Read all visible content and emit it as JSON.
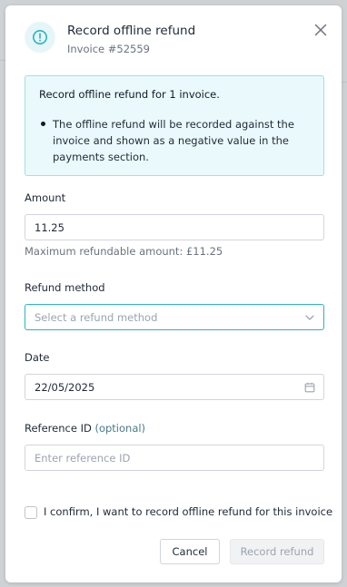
{
  "modal": {
    "title": "Record offline refund",
    "subtitle": "Invoice #52559",
    "icon": "alert-circle-icon",
    "accent_color": "#2bb3c0"
  },
  "info": {
    "title": "Record offline refund for 1 invoice.",
    "bullet": "The offline refund will be recorded against the invoice and shown as a negative value in the payments section."
  },
  "amount": {
    "label": "Amount",
    "value": "11.25",
    "helper": "Maximum refundable amount: £11.25"
  },
  "refund_method": {
    "label": "Refund method",
    "placeholder": "Select a refund method"
  },
  "date": {
    "label": "Date",
    "value": "22/05/2025"
  },
  "reference": {
    "label": "Reference ID",
    "optional": "(optional)",
    "placeholder": "Enter reference ID"
  },
  "confirm": {
    "label": "I confirm, I want to record offline refund for this invoice"
  },
  "buttons": {
    "cancel": "Cancel",
    "submit": "Record refund"
  }
}
